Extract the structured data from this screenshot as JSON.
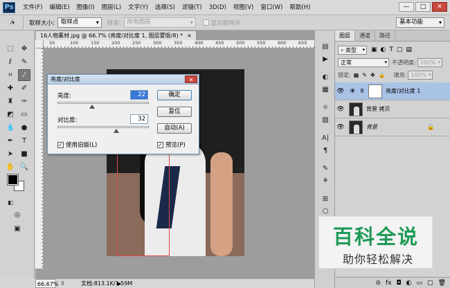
{
  "app": {
    "logo": "Ps",
    "menu": [
      "文件(F)",
      "编辑(E)",
      "图像(I)",
      "图层(L)",
      "文字(Y)",
      "选择(S)",
      "滤镜(T)",
      "3D(D)",
      "视图(V)",
      "窗口(W)",
      "帮助(H)"
    ],
    "window_controls": [
      "—",
      "□",
      "✕"
    ]
  },
  "options_bar": {
    "sample_size_label": "取样大小:",
    "sample_size_value": "取样点",
    "sample_label": "样本:",
    "sample_value": "所有图层",
    "show_ring_label": "显示取样环",
    "workspace": "基本功能"
  },
  "document": {
    "tab_title": "16人物素材.jpg @ 66.7% (亮度/对比度 1, 图层蒙版/8) *",
    "tab_close": "×",
    "ruler_marks": [
      "50",
      "100",
      "150",
      "200",
      "250",
      "300",
      "350",
      "400",
      "450",
      "500",
      "550",
      "600",
      "650"
    ]
  },
  "dialog": {
    "title": "亮度/对比度",
    "close": "✕",
    "brightness_label": "亮度:",
    "brightness_value": "22",
    "contrast_label": "对比度:",
    "contrast_value": "32",
    "ok": "确定",
    "reset": "复位",
    "auto": "自动(A)",
    "use_legacy_label": "使用旧版(L)",
    "use_legacy_checked": true,
    "preview_label": "预览(P)",
    "preview_checked": true
  },
  "status_bar": {
    "zoom": "66.67%",
    "doc_info": "文档:813.1K/1.59M"
  },
  "layers_panel": {
    "tabs": [
      "图层",
      "通道",
      "路径"
    ],
    "filter_kind": "类型",
    "blend_mode": "正常",
    "opacity_label": "不透明度:",
    "opacity_value": "100%",
    "lock_label": "锁定:",
    "fill_label": "填充:",
    "fill_value": "100%",
    "layers": [
      {
        "name": "亮度/对比度 1",
        "selected": true
      },
      {
        "name": "背景 拷贝",
        "selected": false
      },
      {
        "name": "背景",
        "selected": false
      }
    ]
  },
  "watermark": {
    "main": "百科全说",
    "sub": "助你轻松解决"
  }
}
